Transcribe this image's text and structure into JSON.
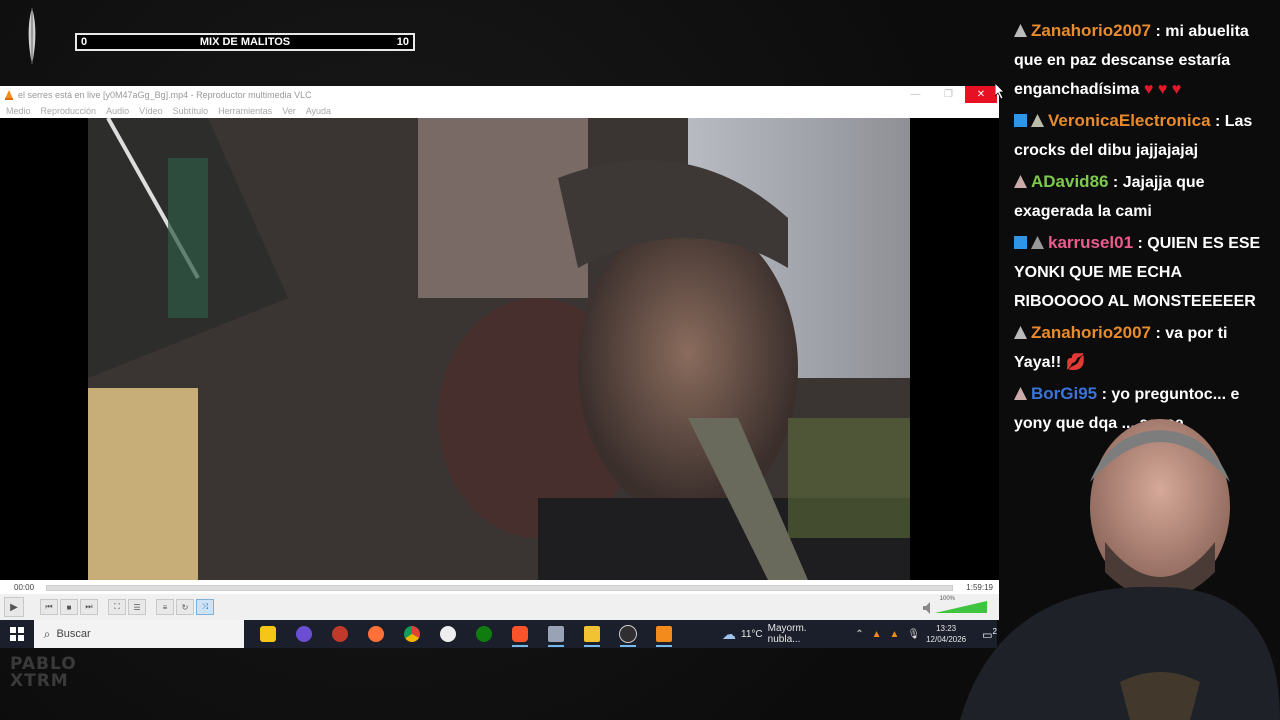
{
  "overlay": {
    "mix_left": "0",
    "mix_title": "MIX DE MALITOS",
    "mix_right": "10",
    "logo_line1": "PABLO",
    "logo_line2": "XTRM"
  },
  "vlc": {
    "title": "el serres está en live [y0M47aGg_Bg].mp4 - Reproductor multimedia VLC",
    "menu": [
      "Medio",
      "Reproducción",
      "Audio",
      "Vídeo",
      "Subtítulo",
      "Herramientas",
      "Ver",
      "Ayuda"
    ],
    "time_elapsed": "00:00",
    "time_total": "1:59:19",
    "volume_label": "100%",
    "volume": 1.0
  },
  "taskbar": {
    "search_placeholder": "Buscar",
    "weather_temp": "11°C",
    "weather_desc": "Mayorm. nubla...",
    "time": "13:23",
    "date": "12/04/2026",
    "notifications": "2"
  },
  "chat": {
    "messages": [
      {
        "user": "Zanahorio2007",
        "color": "#e88b2c",
        "text": "mi abuelita que en paz descanse estaría enganchadísima",
        "extra": "♥ ♥ ♥"
      },
      {
        "user": "VeronicaElectronica",
        "color": "#e88b2c",
        "text": "Las crocks del dibu jajjajajaj",
        "extra": ""
      },
      {
        "user": "ADavid86",
        "color": "#7ec84d",
        "text": "Jajajja que exagerada la cami",
        "extra": ""
      },
      {
        "user": "karrusel01",
        "color": "#ec5b8e",
        "text": "QUIEN ES ESE YONKI QUE ME ECHA RIBOOOOO AL MONSTEEEEER",
        "extra": ""
      },
      {
        "user": "Zanahorio2007",
        "color": "#e88b2c",
        "text": "va por ti Yaya!!",
        "extra": "💋"
      },
      {
        "user": "BorGi95",
        "color": "#3b73d8",
        "text": "yo preguntoc... e yony que dqa ... aaaaa",
        "extra": ""
      }
    ]
  },
  "colors": {
    "accent_close": "#e81123",
    "taskbar_bg": "#1b1f2b",
    "volume_green": "#3ec43e"
  }
}
